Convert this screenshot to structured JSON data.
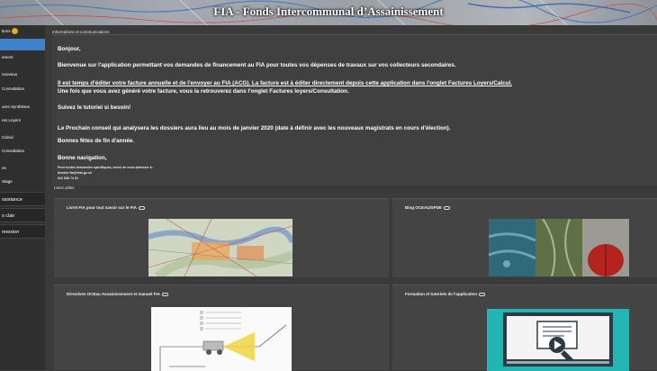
{
  "app": {
    "title": "FIA - Fonds Intercommunal d’Assainissement"
  },
  "colors": {
    "accent": "#3e82c9",
    "badge": "#e8a317",
    "background": "#3a3a3a"
  },
  "sidebar": {
    "items": [
      {
        "label": "tions",
        "badge": "!"
      },
      {
        "label": "",
        "active": true
      },
      {
        "label": "ement"
      },
      {
        "label": "nouveau"
      },
      {
        "label": "Consultation"
      },
      {
        "label": "ures Synthèses"
      },
      {
        "label": "res Loyers"
      },
      {
        "label": "Calcul"
      },
      {
        "label": "Consultation"
      },
      {
        "label": "es"
      },
      {
        "label": "Stage"
      }
    ],
    "sections": [
      {
        "label": "ssistance"
      },
      {
        "label": "s clair"
      },
      {
        "label": "nnexion"
      }
    ]
  },
  "main": {
    "info_label": "Informations et communications",
    "messages": {
      "greeting": "Bonjour,",
      "welcome": "Bienvenue sur l'application permettant vos demandes de financement au FIA pour toutes vos dépenses de travaux sur vos collecteurs secondaires.",
      "invoice_line1": "Il est temps d'éditer votre facture annuelle et de l'envoyer au FIA (ACG). La facture est à éditer directement depuis cette application dans l'onglet Factures Loyers/Calcul.",
      "invoice_line2": "Une fois que vous avez généré votre facture, vous la retrouverez dans l'onglet Factures loyers/Consultation.",
      "tutorial": "Suivez le tutoriel si besoin!",
      "next_council": "Le Prochain conseil qui analysera les dossiers aura lieu au mois de janvier 2020 (date à définir avec les nouveaux magistrats en cours d'élection).",
      "holidays": "Bonnes fêtes de fin d'année.",
      "navigation": "Bonne navigation,",
      "contact_line1": "Pour toutes demandes spécifiques, merci de vous adresser à :",
      "contact_email": "dossier.fia@etat-ge.ch",
      "contact_phone": "022 546 74 31"
    },
    "links_label": "Liens utiles",
    "cards": [
      {
        "title": "Livret FIA pour tout savoir sur le FIA",
        "image_icon": "map-image"
      },
      {
        "title": "Blog OCEAU/SPDE",
        "image_icon": "photos-image"
      },
      {
        "title": "Directives OCEau Assainissement et manuel FIA",
        "image_icon": "diagram-image"
      },
      {
        "title": "Formation et tutoriels de l'application",
        "image_icon": "video-tutorial-image"
      }
    ]
  }
}
